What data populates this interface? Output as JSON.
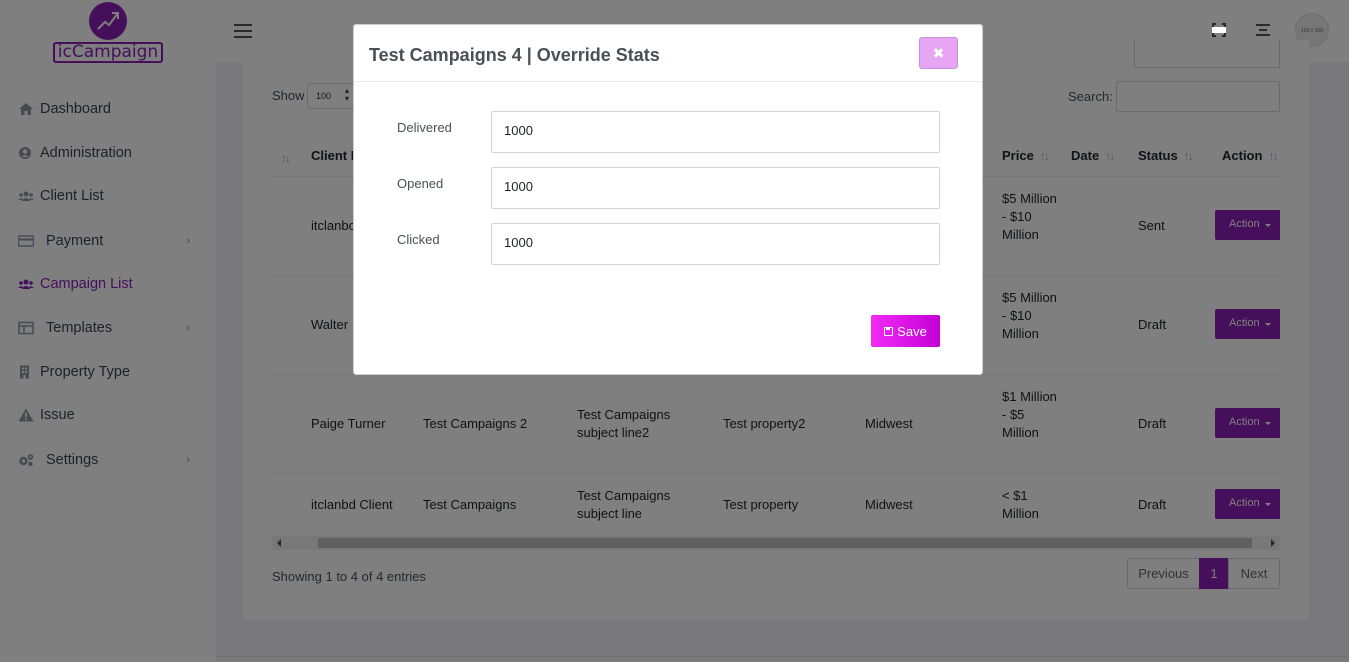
{
  "brand": {
    "name": "icCampaign",
    "accent": "#8a1fb8"
  },
  "sidebar": {
    "items": [
      {
        "label": "Dashboard",
        "icon": "home-icon",
        "active": false,
        "chevron": false
      },
      {
        "label": "Administration",
        "icon": "user-circle-icon",
        "active": false,
        "chevron": false
      },
      {
        "label": "Client List",
        "icon": "users-icon",
        "active": false,
        "chevron": false
      },
      {
        "label": "Payment",
        "icon": "credit-card-icon",
        "active": false,
        "chevron": true
      },
      {
        "label": "Campaign List",
        "icon": "users-icon",
        "active": true,
        "chevron": false
      },
      {
        "label": "Templates",
        "icon": "table-icon",
        "active": false,
        "chevron": true
      },
      {
        "label": "Property Type",
        "icon": "building-icon",
        "active": false,
        "chevron": false
      },
      {
        "label": "Issue",
        "icon": "warning-icon",
        "active": false,
        "chevron": false
      },
      {
        "label": "Settings",
        "icon": "gears-icon",
        "active": false,
        "chevron": true
      }
    ],
    "chevron_glyph": "›"
  },
  "topbar": {
    "avatar_text": "100 x 100"
  },
  "table": {
    "show_label": "Show",
    "page_size": "100",
    "search_label": "Search:",
    "headers": {
      "sort": "↑↓",
      "client": "Client N",
      "price": "Price",
      "date": "Date",
      "status": "Status",
      "action": "Action"
    },
    "rows": [
      {
        "client": "itclanbc",
        "campaign": "",
        "subject": "",
        "property": "",
        "region": "",
        "price": "$5 Million - $10 Million",
        "status": "Sent",
        "action": "Action"
      },
      {
        "client": "Walter",
        "campaign": "",
        "subject": "",
        "property": "",
        "region": "",
        "price": "$5 Million - $10 Million",
        "status": "Draft",
        "action": "Action"
      },
      {
        "client": "Paige Turner",
        "campaign": "Test Campaigns 2",
        "subject": "Test Campaigns subject line2",
        "property": "Test property2",
        "region": "Midwest",
        "price": "$1 Million - $5 Million",
        "status": "Draft",
        "action": "Action"
      },
      {
        "client": "itclanbd Client",
        "campaign": "Test Campaigns",
        "subject": "Test Campaigns subject line",
        "property": "Test property",
        "region": "Midwest",
        "price": "< $1 Million",
        "status": "Draft",
        "action": "Action"
      }
    ],
    "info": "Showing 1 to 4 of 4 entries",
    "pagination": {
      "previous": "Previous",
      "current": "1",
      "next": "Next"
    }
  },
  "modal": {
    "title": "Test Campaigns 4 | Override Stats",
    "close_glyph": "✖",
    "fields": [
      {
        "label": "Delivered",
        "value": "1000"
      },
      {
        "label": "Opened",
        "value": "1000"
      },
      {
        "label": "Clicked",
        "value": "1000"
      }
    ],
    "save_label": "Save"
  }
}
